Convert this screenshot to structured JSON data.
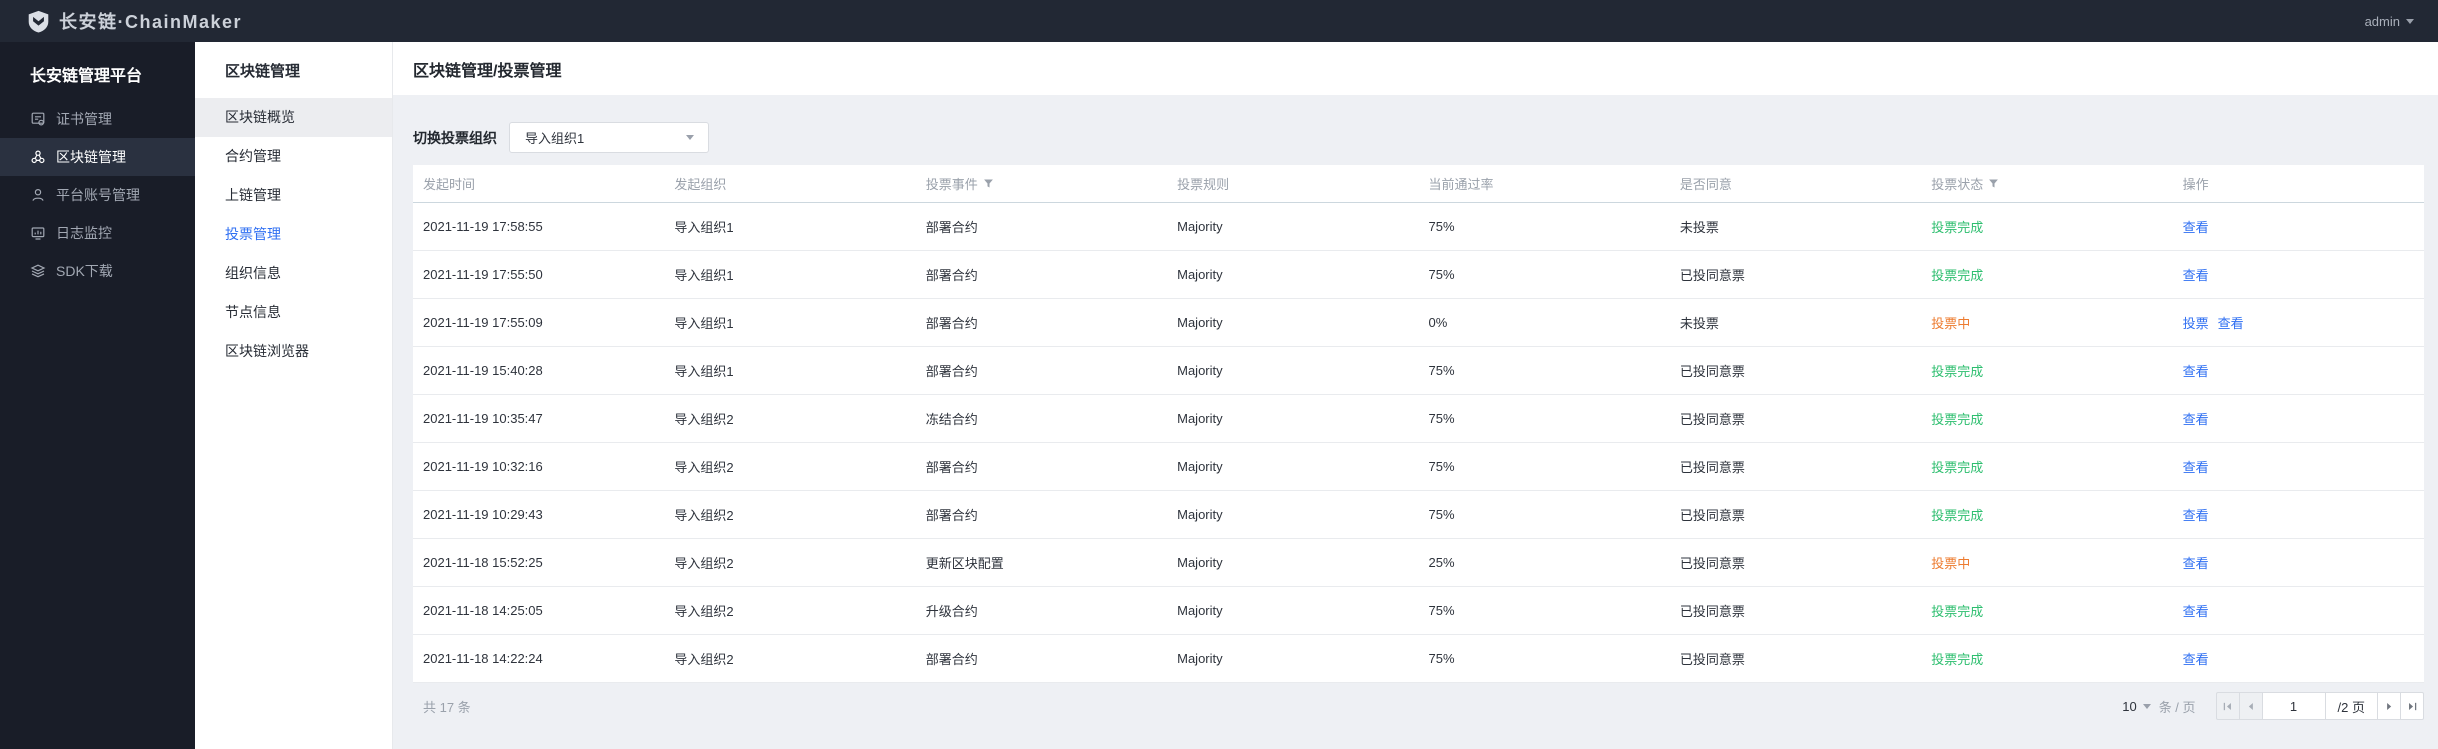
{
  "topbar": {
    "logo_text": "长安链·ChainMaker",
    "user": "admin"
  },
  "sidebar": {
    "title": "长安链管理平台",
    "items": [
      {
        "key": "certificates",
        "label": "证书管理",
        "icon": "certificate-icon",
        "active": false
      },
      {
        "key": "blockchain",
        "label": "区块链管理",
        "icon": "blockchain-icon",
        "active": true
      },
      {
        "key": "accounts",
        "label": "平台账号管理",
        "icon": "account-icon",
        "active": false
      },
      {
        "key": "logs",
        "label": "日志监控",
        "icon": "log-monitor-icon",
        "active": false
      },
      {
        "key": "sdk",
        "label": "SDK下载",
        "icon": "sdk-download-icon",
        "active": false
      }
    ]
  },
  "submenu": {
    "title": "区块链管理",
    "items": [
      {
        "key": "overview",
        "label": "区块链概览",
        "state": "hover"
      },
      {
        "key": "contracts",
        "label": "合约管理",
        "state": "normal"
      },
      {
        "key": "onchain",
        "label": "上链管理",
        "state": "normal"
      },
      {
        "key": "voting",
        "label": "投票管理",
        "state": "active"
      },
      {
        "key": "organizations",
        "label": "组织信息",
        "state": "normal"
      },
      {
        "key": "nodes",
        "label": "节点信息",
        "state": "normal"
      },
      {
        "key": "explorer",
        "label": "区块链浏览器",
        "state": "normal"
      }
    ]
  },
  "main": {
    "breadcrumb": "区块链管理/投票管理",
    "filter": {
      "label": "切换投票组织",
      "value": "导入组织1"
    },
    "table": {
      "columns": [
        {
          "key": "start_time",
          "label": "发起时间",
          "filter": false
        },
        {
          "key": "start_org",
          "label": "发起组织",
          "filter": false
        },
        {
          "key": "vote_event",
          "label": "投票事件",
          "filter": true
        },
        {
          "key": "vote_rule",
          "label": "投票规则",
          "filter": false
        },
        {
          "key": "pass_rate",
          "label": "当前通过率",
          "filter": false
        },
        {
          "key": "agree",
          "label": "是否同意",
          "filter": false
        },
        {
          "key": "vote_status",
          "label": "投票状态",
          "filter": true
        },
        {
          "key": "actions",
          "label": "操作",
          "filter": false
        }
      ],
      "rows": [
        {
          "time": "2021-11-19 17:58:55",
          "org": "导入组织1",
          "event": "部署合约",
          "rule": "Majority",
          "rate": "75%",
          "agree": "未投票",
          "status": "投票完成",
          "status_state": "success",
          "actions": [
            {
              "key": "view",
              "label": "查看"
            }
          ]
        },
        {
          "time": "2021-11-19 17:55:50",
          "org": "导入组织1",
          "event": "部署合约",
          "rule": "Majority",
          "rate": "75%",
          "agree": "已投同意票",
          "status": "投票完成",
          "status_state": "success",
          "actions": [
            {
              "key": "view",
              "label": "查看"
            }
          ]
        },
        {
          "time": "2021-11-19 17:55:09",
          "org": "导入组织1",
          "event": "部署合约",
          "rule": "Majority",
          "rate": "0%",
          "agree": "未投票",
          "status": "投票中",
          "status_state": "processing",
          "actions": [
            {
              "key": "vote",
              "label": "投票"
            },
            {
              "key": "view",
              "label": "查看"
            }
          ]
        },
        {
          "time": "2021-11-19 15:40:28",
          "org": "导入组织1",
          "event": "部署合约",
          "rule": "Majority",
          "rate": "75%",
          "agree": "已投同意票",
          "status": "投票完成",
          "status_state": "success",
          "actions": [
            {
              "key": "view",
              "label": "查看"
            }
          ]
        },
        {
          "time": "2021-11-19 10:35:47",
          "org": "导入组织2",
          "event": "冻结合约",
          "rule": "Majority",
          "rate": "75%",
          "agree": "已投同意票",
          "status": "投票完成",
          "status_state": "success",
          "actions": [
            {
              "key": "view",
              "label": "查看"
            }
          ]
        },
        {
          "time": "2021-11-19 10:32:16",
          "org": "导入组织2",
          "event": "部署合约",
          "rule": "Majority",
          "rate": "75%",
          "agree": "已投同意票",
          "status": "投票完成",
          "status_state": "success",
          "actions": [
            {
              "key": "view",
              "label": "查看"
            }
          ]
        },
        {
          "time": "2021-11-19 10:29:43",
          "org": "导入组织2",
          "event": "部署合约",
          "rule": "Majority",
          "rate": "75%",
          "agree": "已投同意票",
          "status": "投票完成",
          "status_state": "success",
          "actions": [
            {
              "key": "view",
              "label": "查看"
            }
          ]
        },
        {
          "time": "2021-11-18 15:52:25",
          "org": "导入组织2",
          "event": "更新区块配置",
          "rule": "Majority",
          "rate": "25%",
          "agree": "已投同意票",
          "status": "投票中",
          "status_state": "processing",
          "actions": [
            {
              "key": "view",
              "label": "查看"
            }
          ]
        },
        {
          "time": "2021-11-18 14:25:05",
          "org": "导入组织2",
          "event": "升级合约",
          "rule": "Majority",
          "rate": "75%",
          "agree": "已投同意票",
          "status": "投票完成",
          "status_state": "success",
          "actions": [
            {
              "key": "view",
              "label": "查看"
            }
          ]
        },
        {
          "time": "2021-11-18 14:22:24",
          "org": "导入组织2",
          "event": "部署合约",
          "rule": "Majority",
          "rate": "75%",
          "agree": "已投同意票",
          "status": "投票完成",
          "status_state": "success",
          "actions": [
            {
              "key": "view",
              "label": "查看"
            }
          ]
        }
      ]
    },
    "footer": {
      "total": "共 17 条",
      "page_size": "10",
      "page_size_suffix": "条 / 页",
      "current_page": "1",
      "total_pages": "/2 页"
    }
  },
  "colors": {
    "accent_blue": "#2f6ff2",
    "success_green": "#2cbe6e",
    "processing_orange": "#ed7b2f",
    "topbar_bg": "#222834",
    "sidebar_bg": "#191d28"
  }
}
